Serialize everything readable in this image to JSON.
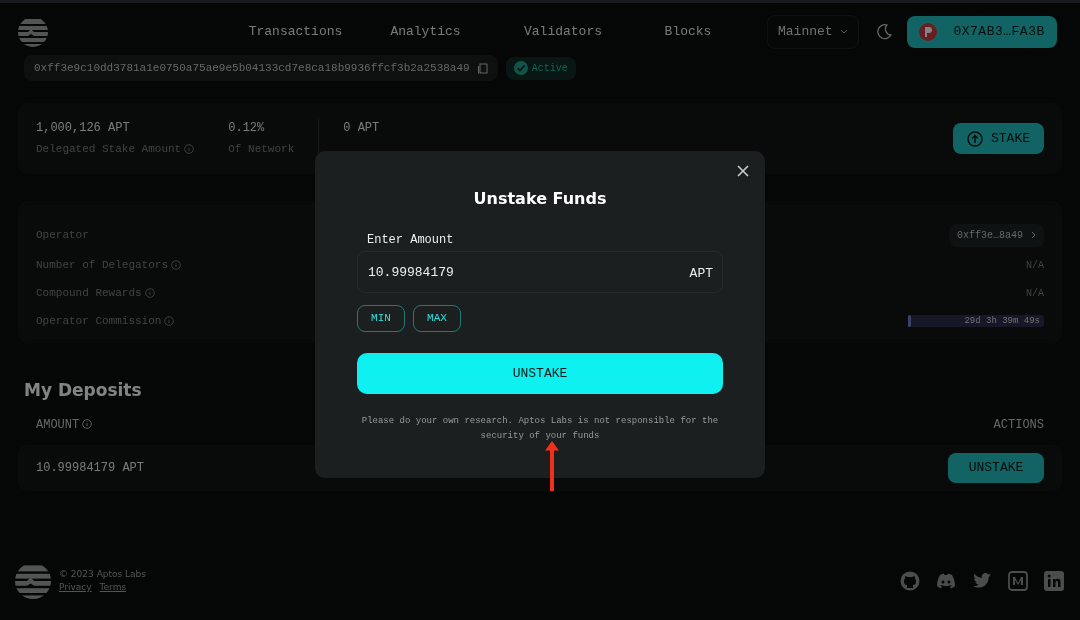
{
  "nav": {
    "links": [
      "Transactions",
      "Analytics",
      "Validators",
      "Blocks"
    ],
    "network": "Mainnet",
    "wallet": "0X7AB3…FA3B"
  },
  "validator": {
    "address": "0xff3e9c10dd3781a1e0750a75ae9e5b04133cd7e8ca18b9936ffcf3b2a2538a49",
    "status": "Active"
  },
  "stats": [
    {
      "value": "1,000,126 APT",
      "label": "Delegated Stake Amount",
      "info": true
    },
    {
      "value": "0.12%",
      "label": "Of Network",
      "info": false
    },
    {
      "value": "0 APT"
    }
  ],
  "stake_button": "STAKE",
  "details": [
    {
      "kind": "link",
      "label": "Operator",
      "info": false,
      "value": "0xff3e…8a49"
    },
    {
      "kind": "text",
      "label": "Number of Delegators",
      "info": true,
      "value": "N/A"
    },
    {
      "kind": "text",
      "label": "Compound Rewards",
      "info": true,
      "value": "N/A"
    },
    {
      "kind": "progress",
      "label": "Operator Commission",
      "info": true,
      "value": "29d 3h 39m 49s",
      "level": 0.02
    }
  ],
  "deposits": {
    "title": "My Deposits",
    "columns": [
      "AMOUNT",
      "ACTIONS"
    ],
    "rows": [
      {
        "amount": "10.99984179 APT",
        "action": "UNSTAKE"
      }
    ]
  },
  "modal": {
    "title": "Unstake Funds",
    "field_label": "Enter Amount",
    "value": "10.99984179",
    "unit": "APT",
    "quick": [
      "MIN",
      "MAX"
    ],
    "submit": "UNSTAKE",
    "disclaimer": "Please do your own research. Aptos Labs is not responsible for the security of your funds"
  },
  "footer": {
    "copyright": "© 2023 Aptos Labs",
    "links": [
      "Privacy",
      "Terms"
    ]
  }
}
